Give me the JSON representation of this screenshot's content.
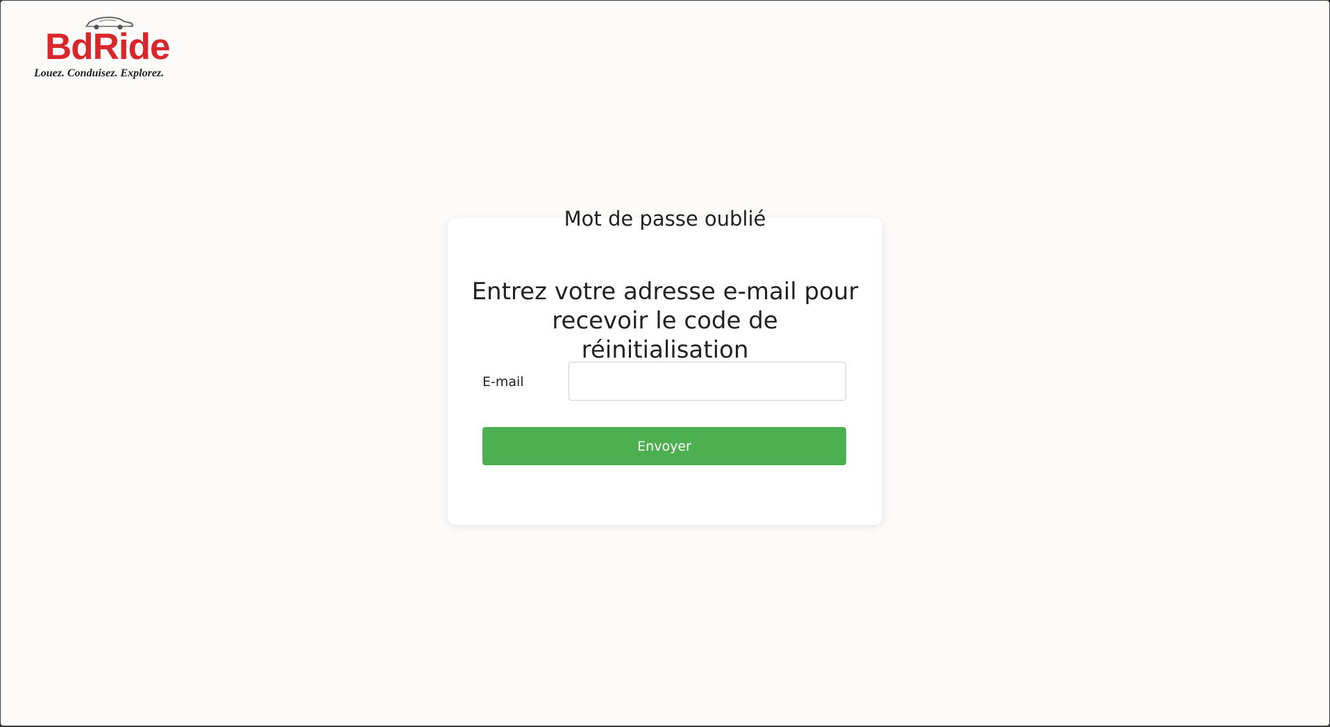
{
  "logo": {
    "brand": "BdRide",
    "tagline": "Louez. Conduisez. Explorez.",
    "brand_color": "#d9262c",
    "icon": "car-icon"
  },
  "card": {
    "title": "Mot de passe oublié",
    "instruction": "Entrez votre adresse e-mail pour recevoir le code de réinitialisation",
    "email_label": "E-mail",
    "email_value": "",
    "email_placeholder": "",
    "submit_label": "Envoyer",
    "submit_color": "#4caf50"
  }
}
